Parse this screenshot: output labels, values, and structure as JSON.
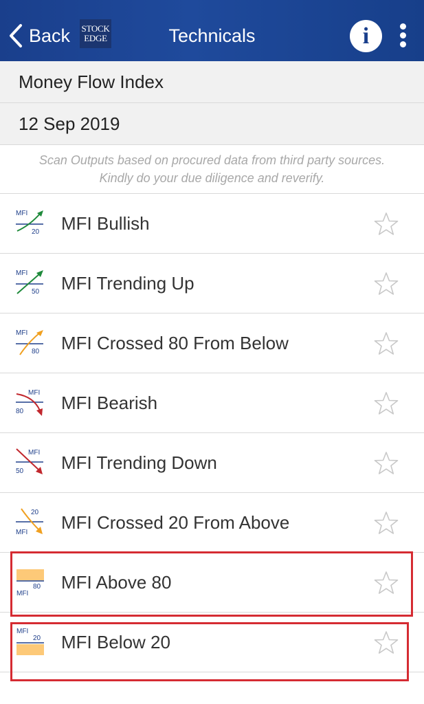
{
  "header": {
    "back_label": "Back",
    "logo_top": "STOCK",
    "logo_bottom": "EDGE",
    "title": "Technicals",
    "info_label": "i"
  },
  "indicator_name": "Money Flow Index",
  "date": "12 Sep 2019",
  "disclaimer": {
    "line1": "Scan Outputs based on procured data from third party sources.",
    "line2": "Kindly do your due diligence and reverify."
  },
  "scans": [
    {
      "label": "MFI Bullish",
      "icon": "mfi-bullish-icon",
      "badge_top": "MFI",
      "badge_bottom": "20"
    },
    {
      "label": "MFI Trending Up",
      "icon": "mfi-trending-up-icon",
      "badge_top": "MFI",
      "badge_bottom": "50"
    },
    {
      "label": "MFI Crossed 80 From Below",
      "icon": "mfi-crossed-80-icon",
      "badge_top": "MFI",
      "badge_bottom": "80"
    },
    {
      "label": "MFI Bearish",
      "icon": "mfi-bearish-icon",
      "badge_top": "MFI",
      "badge_bottom": "80"
    },
    {
      "label": "MFI Trending Down",
      "icon": "mfi-trending-down-icon",
      "badge_top": "MFI",
      "badge_bottom": "50"
    },
    {
      "label": "MFI Crossed 20 From Above",
      "icon": "mfi-crossed-20-icon",
      "badge_top": "20",
      "badge_bottom": "MFI"
    },
    {
      "label": "MFI Above 80",
      "icon": "mfi-above-80-icon",
      "badge_top": "80",
      "badge_bottom": "MFI"
    },
    {
      "label": "MFI Below 20",
      "icon": "mfi-below-20-icon",
      "badge_top": "MFI",
      "badge_bottom": "20"
    }
  ],
  "colors": {
    "header": "#1a3f8c",
    "bullish_arrow": "#1f8a3b",
    "warn_arrow": "#f0a020",
    "bearish_arrow": "#c1272d",
    "band": "#fdc978",
    "highlight": "#d52b32",
    "star": "#c8c8c8"
  }
}
